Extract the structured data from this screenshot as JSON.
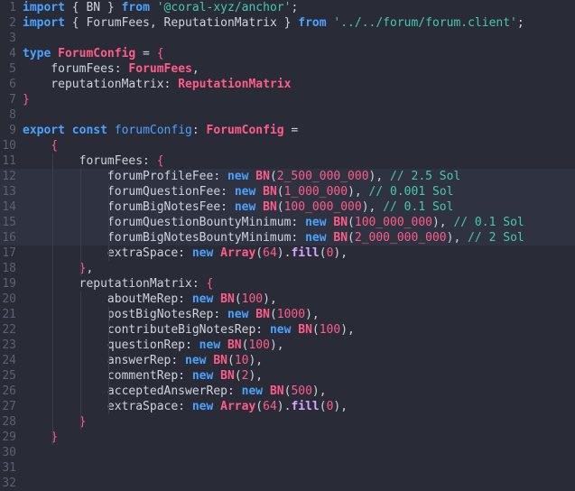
{
  "editor": {
    "lines": [
      {
        "n": "1",
        "tokens": [
          [
            "kw",
            "import"
          ],
          [
            "plain",
            " { BN } "
          ],
          [
            "kw",
            "from"
          ],
          [
            "plain",
            " "
          ],
          [
            "str",
            "'@coral-xyz/anchor'"
          ],
          [
            "plain",
            ";"
          ]
        ]
      },
      {
        "n": "2",
        "tokens": [
          [
            "kw",
            "import"
          ],
          [
            "plain",
            " { ForumFees, ReputationMatrix } "
          ],
          [
            "kw",
            "from"
          ],
          [
            "plain",
            " "
          ],
          [
            "str",
            "'../../forum/forum.client'"
          ],
          [
            "plain",
            ";"
          ]
        ]
      },
      {
        "n": "3",
        "tokens": []
      },
      {
        "n": "4",
        "tokens": [
          [
            "kw",
            "type"
          ],
          [
            "plain",
            " "
          ],
          [
            "type",
            "ForumConfig"
          ],
          [
            "plain",
            " = "
          ],
          [
            "brace",
            "{"
          ]
        ]
      },
      {
        "n": "5",
        "tokens": [
          [
            "plain",
            "    forumFees: "
          ],
          [
            "cls",
            "ForumFees"
          ],
          [
            "plain",
            ","
          ]
        ]
      },
      {
        "n": "6",
        "tokens": [
          [
            "plain",
            "    reputationMatrix: "
          ],
          [
            "cls",
            "ReputationMatrix"
          ]
        ]
      },
      {
        "n": "7",
        "tokens": [
          [
            "brace",
            "}"
          ]
        ]
      },
      {
        "n": "8",
        "tokens": []
      },
      {
        "n": "9",
        "tokens": [
          [
            "kw",
            "export"
          ],
          [
            "plain",
            " "
          ],
          [
            "kw",
            "const"
          ],
          [
            "plain",
            " "
          ],
          [
            "decl",
            "forumConfig"
          ],
          [
            "plain",
            ": "
          ],
          [
            "type",
            "ForumConfig"
          ],
          [
            "plain",
            " ="
          ]
        ]
      },
      {
        "n": "10",
        "tokens": [
          [
            "plain",
            "    "
          ],
          [
            "brace",
            "{"
          ]
        ]
      },
      {
        "n": "11",
        "tokens": [
          [
            "plain",
            "        forumFees: "
          ],
          [
            "brace",
            "{"
          ]
        ]
      },
      {
        "n": "12",
        "hl": true,
        "tokens": [
          [
            "plain",
            "            forumProfileFee: "
          ],
          [
            "new",
            "new"
          ],
          [
            "plain",
            " "
          ],
          [
            "cls",
            "BN"
          ],
          [
            "plain",
            "("
          ],
          [
            "num",
            "2_500_000_000"
          ],
          [
            "plain",
            "), "
          ],
          [
            "com",
            "// 2.5 Sol"
          ]
        ]
      },
      {
        "n": "13",
        "hl": true,
        "tokens": [
          [
            "plain",
            "            forumQuestionFee: "
          ],
          [
            "new",
            "new"
          ],
          [
            "plain",
            " "
          ],
          [
            "cls",
            "BN"
          ],
          [
            "plain",
            "("
          ],
          [
            "num",
            "1_000_000"
          ],
          [
            "plain",
            "), "
          ],
          [
            "com",
            "// 0.001 Sol"
          ]
        ]
      },
      {
        "n": "14",
        "hl": true,
        "tokens": [
          [
            "plain",
            "            forumBigNotesFee: "
          ],
          [
            "new",
            "new"
          ],
          [
            "plain",
            " "
          ],
          [
            "cls",
            "BN"
          ],
          [
            "plain",
            "("
          ],
          [
            "num",
            "100_000_000"
          ],
          [
            "plain",
            "), "
          ],
          [
            "com",
            "// 0.1 Sol"
          ]
        ]
      },
      {
        "n": "15",
        "hl": true,
        "tokens": [
          [
            "plain",
            "            forumQuestionBountyMinimum: "
          ],
          [
            "new",
            "new"
          ],
          [
            "plain",
            " "
          ],
          [
            "cls",
            "BN"
          ],
          [
            "plain",
            "("
          ],
          [
            "num",
            "100_000_000"
          ],
          [
            "plain",
            "), "
          ],
          [
            "com",
            "// 0.1 Sol"
          ]
        ]
      },
      {
        "n": "16",
        "hl": true,
        "tokens": [
          [
            "plain",
            "            forumBigNotesBountyMinimum: "
          ],
          [
            "new",
            "new"
          ],
          [
            "plain",
            " "
          ],
          [
            "cls",
            "BN"
          ],
          [
            "plain",
            "("
          ],
          [
            "num",
            "2_000_000_000"
          ],
          [
            "plain",
            "), "
          ],
          [
            "com",
            "// 2 Sol"
          ]
        ]
      },
      {
        "n": "17",
        "tokens": [
          [
            "plain",
            "            extraSpace: "
          ],
          [
            "new",
            "new"
          ],
          [
            "plain",
            " "
          ],
          [
            "cls",
            "Array"
          ],
          [
            "plain",
            "("
          ],
          [
            "num",
            "64"
          ],
          [
            "plain",
            ")."
          ],
          [
            "fn",
            "fill"
          ],
          [
            "plain",
            "("
          ],
          [
            "num",
            "0"
          ],
          [
            "plain",
            "),"
          ]
        ]
      },
      {
        "n": "18",
        "tokens": [
          [
            "plain",
            "        "
          ],
          [
            "brace",
            "}"
          ],
          [
            "plain",
            ","
          ]
        ]
      },
      {
        "n": "19",
        "tokens": [
          [
            "plain",
            "        reputationMatrix: "
          ],
          [
            "brace",
            "{"
          ]
        ]
      },
      {
        "n": "20",
        "tokens": [
          [
            "plain",
            "            aboutMeRep: "
          ],
          [
            "new",
            "new"
          ],
          [
            "plain",
            " "
          ],
          [
            "cls",
            "BN"
          ],
          [
            "plain",
            "("
          ],
          [
            "num",
            "100"
          ],
          [
            "plain",
            "),"
          ]
        ]
      },
      {
        "n": "21",
        "tokens": [
          [
            "plain",
            "            postBigNotesRep: "
          ],
          [
            "new",
            "new"
          ],
          [
            "plain",
            " "
          ],
          [
            "cls",
            "BN"
          ],
          [
            "plain",
            "("
          ],
          [
            "num",
            "1000"
          ],
          [
            "plain",
            "),"
          ]
        ]
      },
      {
        "n": "22",
        "tokens": [
          [
            "plain",
            "            contributeBigNotesRep: "
          ],
          [
            "new",
            "new"
          ],
          [
            "plain",
            " "
          ],
          [
            "cls",
            "BN"
          ],
          [
            "plain",
            "("
          ],
          [
            "num",
            "100"
          ],
          [
            "plain",
            "),"
          ]
        ]
      },
      {
        "n": "23",
        "tokens": [
          [
            "plain",
            "            questionRep: "
          ],
          [
            "new",
            "new"
          ],
          [
            "plain",
            " "
          ],
          [
            "cls",
            "BN"
          ],
          [
            "plain",
            "("
          ],
          [
            "num",
            "100"
          ],
          [
            "plain",
            "),"
          ]
        ]
      },
      {
        "n": "24",
        "tokens": [
          [
            "plain",
            "            answerRep: "
          ],
          [
            "new",
            "new"
          ],
          [
            "plain",
            " "
          ],
          [
            "cls",
            "BN"
          ],
          [
            "plain",
            "("
          ],
          [
            "num",
            "10"
          ],
          [
            "plain",
            "),"
          ]
        ]
      },
      {
        "n": "25",
        "tokens": [
          [
            "plain",
            "            commentRep: "
          ],
          [
            "new",
            "new"
          ],
          [
            "plain",
            " "
          ],
          [
            "cls",
            "BN"
          ],
          [
            "plain",
            "("
          ],
          [
            "num",
            "2"
          ],
          [
            "plain",
            "),"
          ]
        ]
      },
      {
        "n": "26",
        "tokens": [
          [
            "plain",
            "            acceptedAnswerRep: "
          ],
          [
            "new",
            "new"
          ],
          [
            "plain",
            " "
          ],
          [
            "cls",
            "BN"
          ],
          [
            "plain",
            "("
          ],
          [
            "num",
            "500"
          ],
          [
            "plain",
            "),"
          ]
        ]
      },
      {
        "n": "27",
        "tokens": [
          [
            "plain",
            "            extraSpace: "
          ],
          [
            "new",
            "new"
          ],
          [
            "plain",
            " "
          ],
          [
            "cls",
            "Array"
          ],
          [
            "plain",
            "("
          ],
          [
            "num",
            "64"
          ],
          [
            "plain",
            ")."
          ],
          [
            "fn",
            "fill"
          ],
          [
            "plain",
            "("
          ],
          [
            "num",
            "0"
          ],
          [
            "plain",
            "),"
          ]
        ]
      },
      {
        "n": "28",
        "tokens": [
          [
            "plain",
            "        "
          ],
          [
            "brace",
            "}"
          ]
        ]
      },
      {
        "n": "29",
        "tokens": [
          [
            "plain",
            "    "
          ],
          [
            "brace",
            "}"
          ]
        ]
      },
      {
        "n": "30",
        "tokens": []
      },
      {
        "n": "31",
        "tokens": []
      },
      {
        "n": "32",
        "tokens": []
      }
    ]
  }
}
